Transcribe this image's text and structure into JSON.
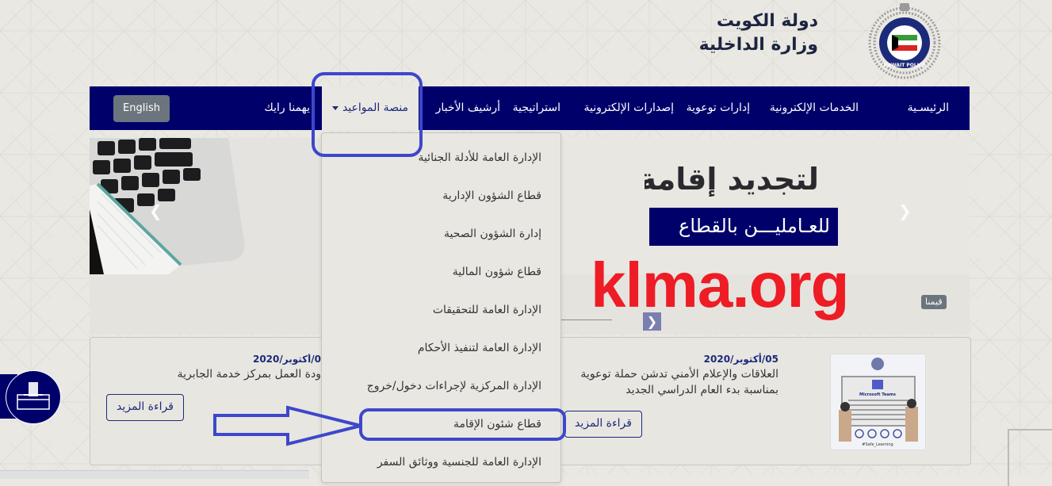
{
  "header": {
    "title_line1": "دولة الكويت",
    "title_line2": "وزارة الداخلية",
    "logo_alt": "KUWAIT POLICE"
  },
  "navbar": {
    "items": [
      {
        "label": "الرئيسـية"
      },
      {
        "label": "الخدمات الإلكترونية"
      },
      {
        "label": "إدارات توعوية"
      },
      {
        "label": "إصدارات الإلكترونية"
      },
      {
        "label": "استراتيجية"
      },
      {
        "label": "أرشيف الأخبار"
      },
      {
        "label": "منصة المواعيد"
      },
      {
        "label": "يهمنا رايك"
      }
    ],
    "language_button": "English"
  },
  "dropdown": {
    "items": [
      "الإدارة العامة للأدلة الجنائية",
      "قطاع الشؤون الإدارية",
      "إدارة الشؤون الصحية",
      "قطاع شؤون المالية",
      "الإدارة العامة للتحقيقات",
      "الإدارة العامة لتنفيذ الأحكام",
      "الإدارة المركزية لإجراءات دخول/خروج",
      "قطاع شئون الإقامة",
      "الإدارة العامة للجنسية ووثائق السفر"
    ],
    "highlighted_index": 7
  },
  "hero": {
    "title": "لتجديد إقامة",
    "subtitle": "للعـامليـــن بالقطاع",
    "prev_icon": "chevron-left",
    "next_icon": "chevron-right"
  },
  "section": {
    "badge": "قيمنا",
    "next_icon": "chevron-right"
  },
  "news": [
    {
      "date": "05/أكتوبر/2020",
      "title_line1": "العلاقات والإعلام الأمني تدشن حملة توعوية",
      "title_line2": "بمناسبة بدء العام الدراسي الجديد",
      "button": "قراءة المزيد",
      "thumb_caption": "تعليم آمن.. مع (Microsoft Teams)"
    },
    {
      "date": "0/أكتوبر/2020",
      "title_line1": "ودة العمل بمركز خدمة الجابرية",
      "button": "قراءة المزيد"
    }
  ],
  "watermark": "klma.org",
  "colors": {
    "navy": "#00006b",
    "annotation_blue": "#3d47cc",
    "watermark_red": "#ee1c25",
    "background": "#eae8e2"
  }
}
